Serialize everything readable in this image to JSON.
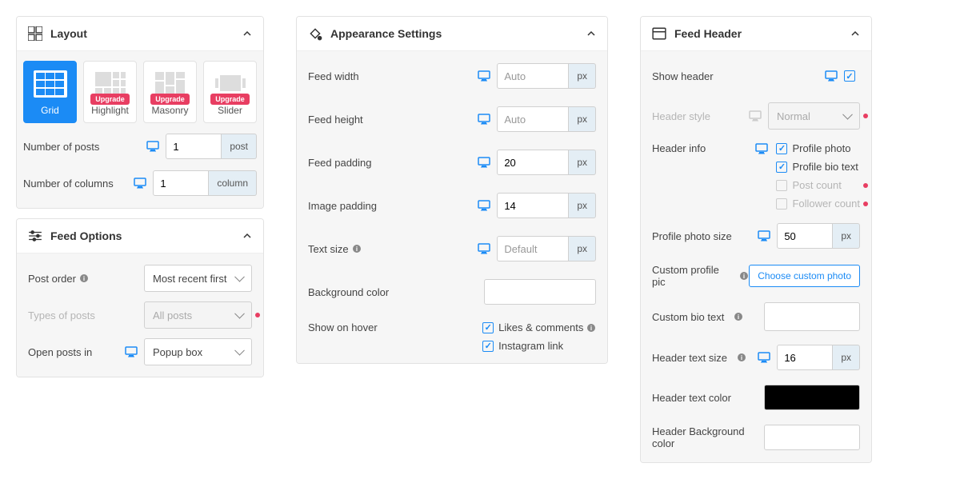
{
  "layout": {
    "title": "Layout",
    "cards": [
      {
        "label": "Grid",
        "active": true
      },
      {
        "label": "Highlight",
        "upgrade": "Upgrade"
      },
      {
        "label": "Masonry",
        "upgrade": "Upgrade"
      },
      {
        "label": "Slider",
        "upgrade": "Upgrade"
      }
    ],
    "num_posts": {
      "label": "Number of posts",
      "value": "1",
      "unit": "post"
    },
    "num_columns": {
      "label": "Number of columns",
      "value": "1",
      "unit": "column"
    }
  },
  "feed_options": {
    "title": "Feed Options",
    "post_order": {
      "label": "Post order",
      "value": "Most recent first"
    },
    "types": {
      "label": "Types of posts",
      "value": "All posts"
    },
    "open_in": {
      "label": "Open posts in",
      "value": "Popup box"
    }
  },
  "appearance": {
    "title": "Appearance Settings",
    "feed_width": {
      "label": "Feed width",
      "placeholder": "Auto",
      "unit": "px"
    },
    "feed_height": {
      "label": "Feed height",
      "placeholder": "Auto",
      "unit": "px"
    },
    "feed_padding": {
      "label": "Feed padding",
      "value": "20",
      "unit": "px"
    },
    "image_padding": {
      "label": "Image padding",
      "value": "14",
      "unit": "px"
    },
    "text_size": {
      "label": "Text size",
      "placeholder": "Default",
      "unit": "px"
    },
    "bg_color": {
      "label": "Background color"
    },
    "show_hover": {
      "label": "Show on hover",
      "likes": "Likes & comments",
      "instagram": "Instagram link"
    }
  },
  "feed_header": {
    "title": "Feed Header",
    "show_header": {
      "label": "Show header"
    },
    "header_style": {
      "label": "Header style",
      "value": "Normal"
    },
    "header_info": {
      "label": "Header info",
      "photo": "Profile photo",
      "bio": "Profile bio text",
      "posts": "Post count",
      "followers": "Follower count"
    },
    "photo_size": {
      "label": "Profile photo size",
      "value": "50",
      "unit": "px"
    },
    "custom_pic": {
      "label": "Custom profile pic",
      "button": "Choose custom photo"
    },
    "custom_bio": {
      "label": "Custom bio text"
    },
    "text_size": {
      "label": "Header text size",
      "value": "16",
      "unit": "px"
    },
    "text_color": {
      "label": "Header text color"
    },
    "bg_color": {
      "label": "Header Background color"
    }
  }
}
